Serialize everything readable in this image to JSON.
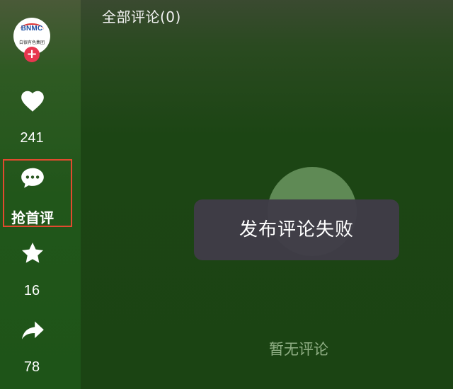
{
  "panel": {
    "title": "全部评论(0)",
    "empty_text": "暂无评论"
  },
  "toast": {
    "message": "发布评论失败"
  },
  "rail": {
    "avatar": {
      "logo_text": "BNMC",
      "logo_sub": "白银有色集团"
    },
    "follow_icon": "plus-icon",
    "follow_symbol": "+",
    "like": {
      "icon": "heart-icon",
      "count": "241"
    },
    "comment": {
      "icon": "comment-bubble-icon",
      "label": "抢首评"
    },
    "favorite": {
      "icon": "star-icon",
      "count": "16"
    },
    "share": {
      "icon": "share-arrow-icon",
      "count": "78"
    }
  },
  "colors": {
    "highlight_border": "#e24a2f",
    "follow_badge": "#e8364f",
    "toast_bg": "#403c48"
  }
}
